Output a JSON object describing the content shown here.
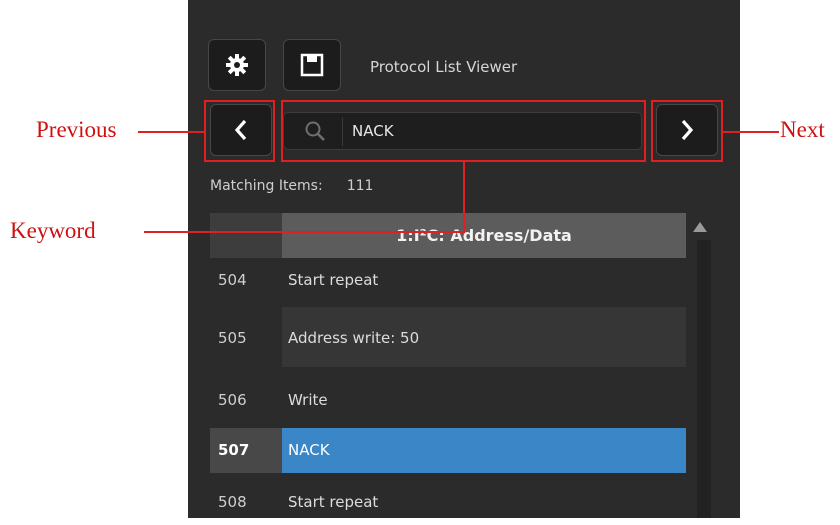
{
  "panel": {
    "title": "Protocol List Viewer",
    "search": {
      "value": "NACK"
    },
    "matching_label": "Matching Items:",
    "matching_count": "111",
    "column_header": "1:I²C: Address/Data",
    "rows": [
      {
        "index": "504",
        "text": "Start repeat"
      },
      {
        "index": "505",
        "text": "Address write: 50"
      },
      {
        "index": "506",
        "text": "Write"
      },
      {
        "index": "507",
        "text": "NACK"
      },
      {
        "index": "508",
        "text": "Start repeat"
      }
    ],
    "selected_row": "507",
    "icons": [
      "gear-icon",
      "save-icon",
      "chevron-left-icon",
      "search-icon",
      "chevron-right-icon",
      "scroll-up-icon"
    ]
  },
  "annotations": {
    "previous": "Previous",
    "next": "Next",
    "keyword": "Keyword"
  },
  "colors": {
    "panel_bg": "#2b2b2b",
    "selection": "#3a86c6",
    "annotation_red": "#e02020"
  }
}
